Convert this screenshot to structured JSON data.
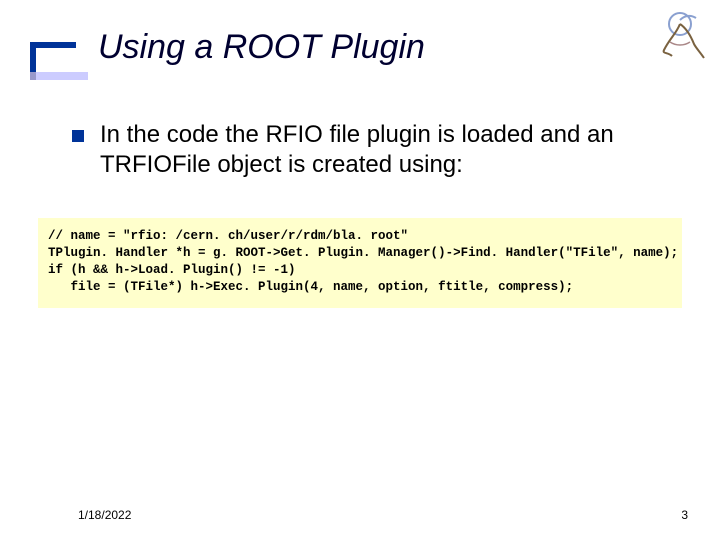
{
  "title": "Using a ROOT Plugin",
  "bullet": "In the code the RFIO file plugin is loaded and an TRFIOFile object is created using:",
  "code": "// name = \"rfio: /cern. ch/user/r/rdm/bla. root\"\nTPlugin. Handler *h = g. ROOT->Get. Plugin. Manager()->Find. Handler(\"TFile\", name);\nif (h && h->Load. Plugin() != -1)\n   file = (TFile*) h->Exec. Plugin(4, name, option, ftitle, compress);",
  "footer": {
    "date": "1/18/2022",
    "page": "3"
  }
}
